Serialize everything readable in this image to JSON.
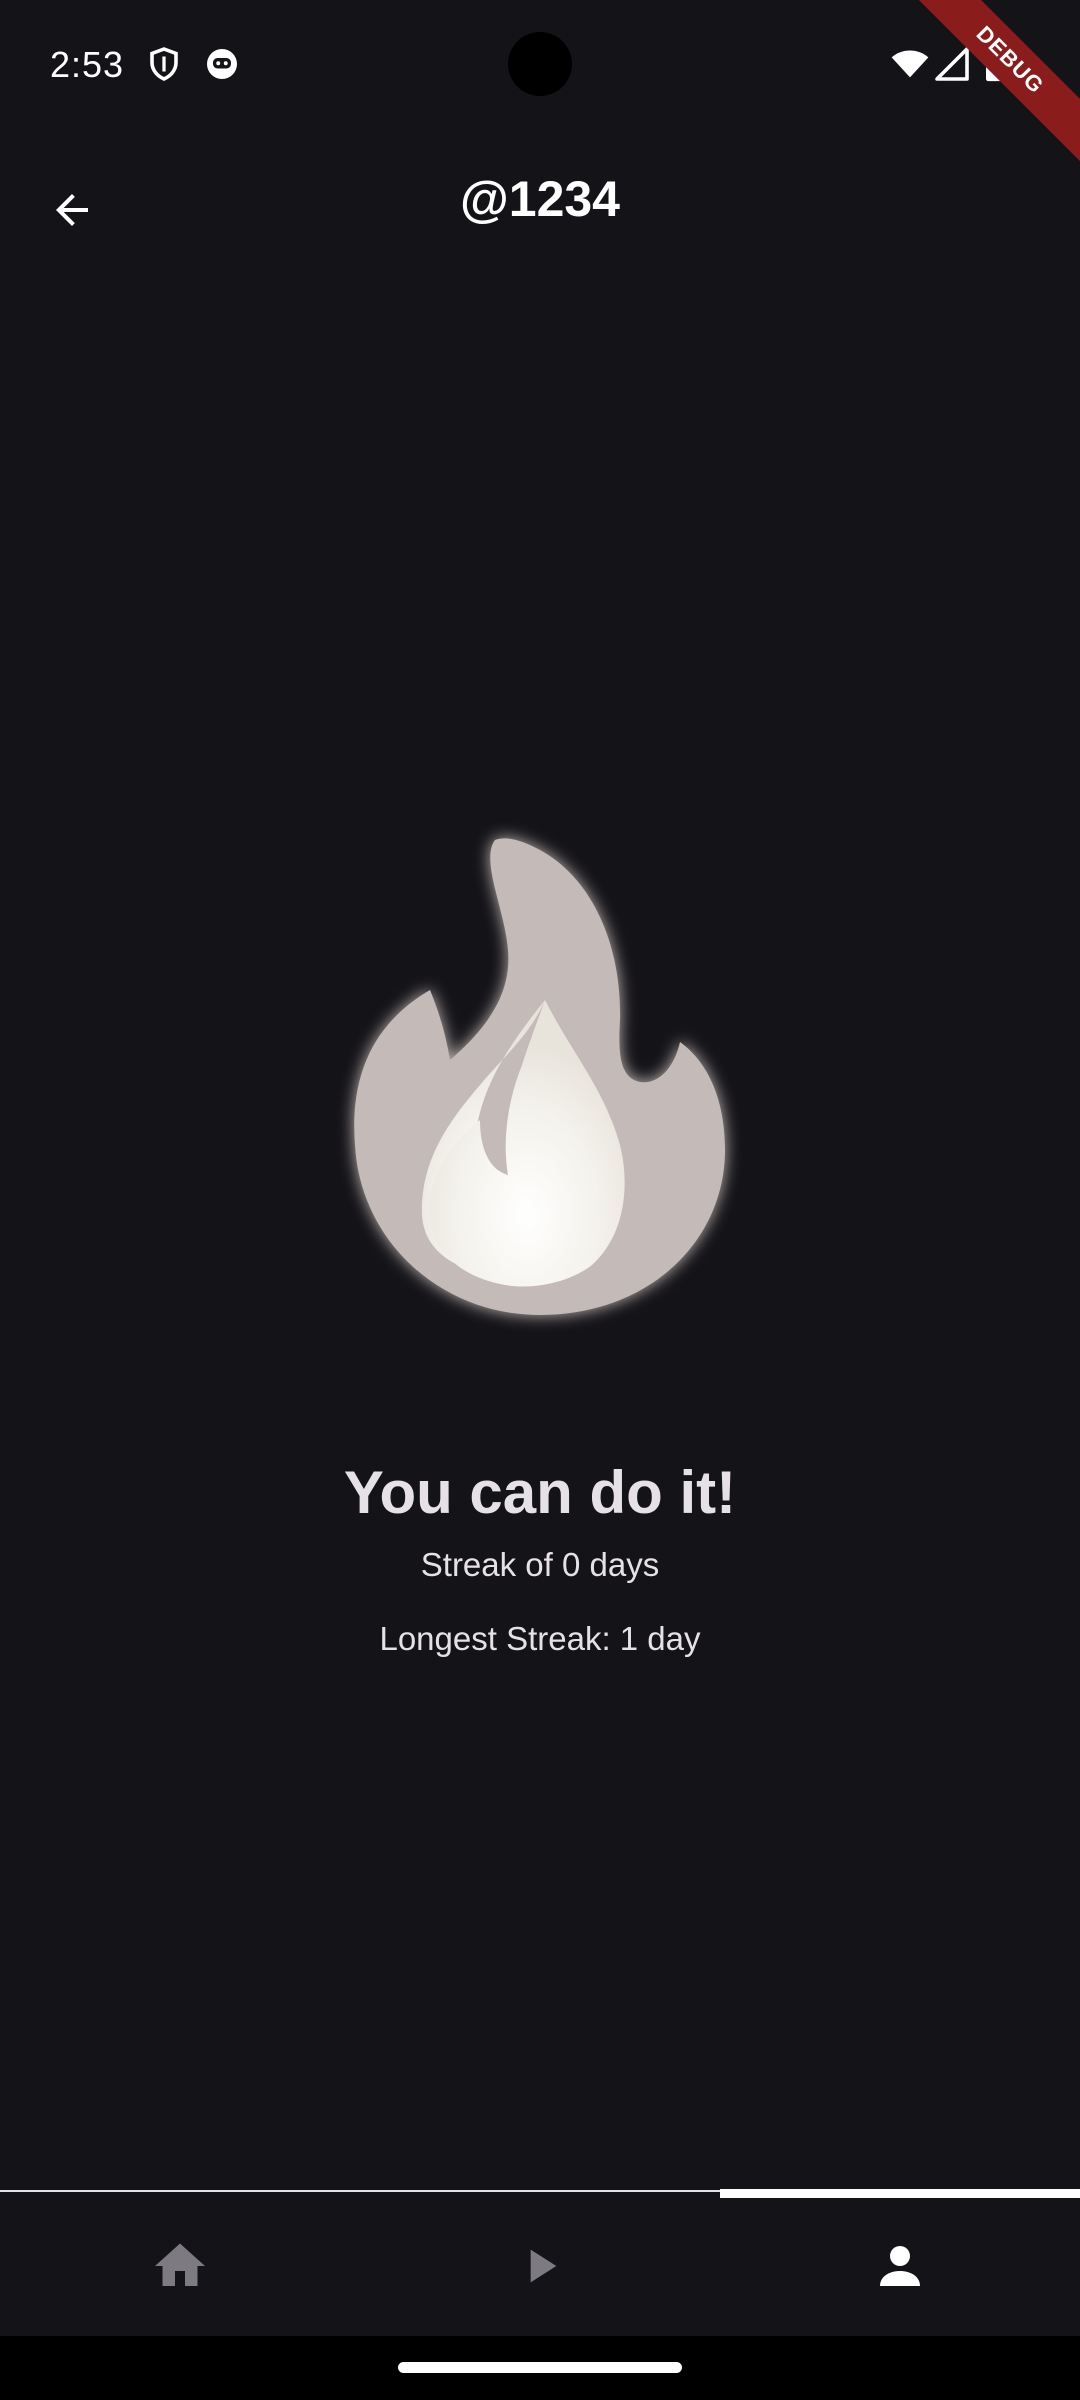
{
  "status_bar": {
    "time": "2:53",
    "left_icons": [
      "shield-icon",
      "face-icon"
    ],
    "right_icons": [
      "wifi-icon",
      "signal-icon",
      "battery-icon"
    ]
  },
  "debug_banner": "DEBUG",
  "app_bar": {
    "title": "@1234",
    "back_icon": "arrow-back-icon"
  },
  "streak": {
    "icon": "fire-icon",
    "headline": "You can do it!",
    "current_text": "Streak of 0 days",
    "longest_text": "Longest Streak: 1 day"
  },
  "bottom_nav": {
    "items": [
      {
        "icon": "home-icon",
        "active": false
      },
      {
        "icon": "play-icon",
        "active": false
      },
      {
        "icon": "person-icon",
        "active": true
      }
    ]
  },
  "colors": {
    "background": "#141318",
    "text": "#E6E1E6",
    "inactive_icon": "#7D7A82",
    "active_icon": "#FFFFFF",
    "debug_ribbon": "#8B1C1C"
  }
}
